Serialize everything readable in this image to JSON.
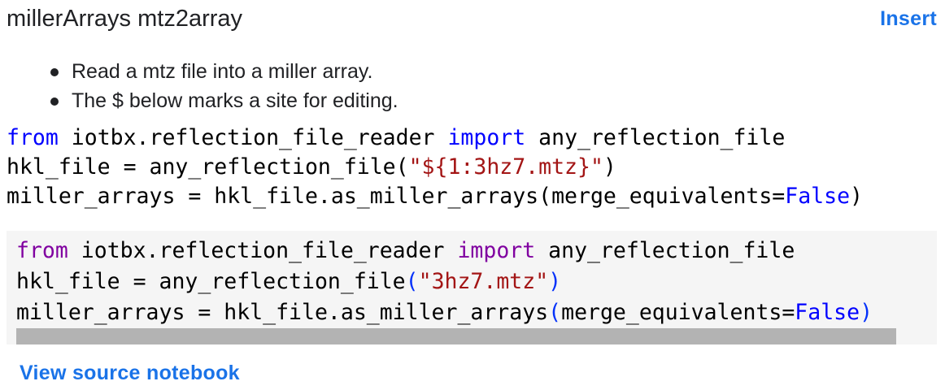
{
  "header": {
    "title": "millerArrays mtz2array",
    "insert_label": "Insert"
  },
  "description": {
    "bullets": [
      "Read a mtz file into a miller array.",
      "The $ below marks a site for editing."
    ]
  },
  "template_code": {
    "line1": {
      "kw1": "from",
      "mod": " iotbx.reflection_file_reader ",
      "kw2": "import",
      "name": " any_reflection_file"
    },
    "line2": {
      "pre": "hkl_file = any_reflection_file(",
      "str": "\"${1:3hz7.mtz}\"",
      "post": ")"
    },
    "line3": {
      "pre": "miller_arrays = hkl_file.as_miller_arrays(merge_equivalents=",
      "const": "False",
      "post": ")"
    }
  },
  "preview_code": {
    "line1": {
      "kw1": "from",
      "mod": " iotbx.reflection_file_reader ",
      "kw2": "import",
      "name": " any_reflection_file"
    },
    "line2": {
      "pre": "hkl_file = any_reflection_file",
      "open": "(",
      "str": "\"3hz7.mtz\"",
      "close": ")"
    },
    "line3": {
      "pre": "miller_arrays = hkl_file.as_miller_arrays",
      "open": "(",
      "mid": "merge_equivalents=",
      "const": "False",
      "close": ")"
    }
  },
  "footer": {
    "view_source_label": "View source notebook"
  },
  "colors": {
    "link": "#1a73e8",
    "keyword": "#8000a0",
    "keyword_plain": "#0000ff",
    "string": "#a31515",
    "constant": "#0000ff",
    "code_background": "#f5f5f5",
    "scrollbar": "#b3b3b3"
  }
}
